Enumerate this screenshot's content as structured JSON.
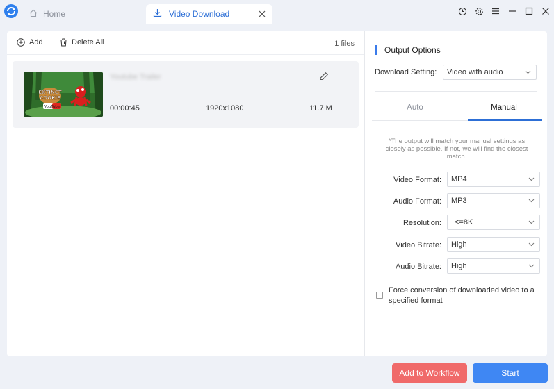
{
  "titlebar": {
    "tabs": [
      {
        "label": "Home",
        "icon": "home-icon"
      },
      {
        "label": "Video Download",
        "icon": "download-icon"
      }
    ],
    "window_buttons": [
      "clock-icon",
      "gear-icon",
      "menu-icon",
      "minimize-icon",
      "maximize-icon",
      "close-icon"
    ]
  },
  "toolbar": {
    "add_label": "Add",
    "delete_label": "Delete All",
    "file_count": "1 files"
  },
  "files": [
    {
      "title": "Youtube Trailer",
      "thumbnail_text_1": "EXTINCT",
      "thumbnail_text_2": "COOKIE",
      "thumbnail_badge": "YouTube",
      "duration": "00:00:45",
      "resolution": "1920x1080",
      "size": "11.7 M"
    }
  ],
  "options": {
    "title": "Output Options",
    "download_setting_label": "Download Setting:",
    "download_setting_value": "Video with audio",
    "mode_tabs": [
      "Auto",
      "Manual"
    ],
    "active_mode": "Manual",
    "note": "*The output will match your manual settings as closely as possible. If not, we will find the closest match.",
    "fields": [
      {
        "label": "Video Format:",
        "value": "MP4"
      },
      {
        "label": "Audio Format:",
        "value": "MP3"
      },
      {
        "label": "Resolution:",
        "value": "<=8K"
      },
      {
        "label": "Video Bitrate:",
        "value": "High"
      },
      {
        "label": "Audio Bitrate:",
        "value": "High"
      }
    ],
    "force_label": "Force conversion of downloaded video to a specified format",
    "force_checked": false
  },
  "actions": {
    "workflow_label": "Add to Workflow",
    "start_label": "Start"
  },
  "colors": {
    "accent": "#3f87f3",
    "workflow": "#f06a6a",
    "active_tab_text": "#2d6fd6"
  }
}
